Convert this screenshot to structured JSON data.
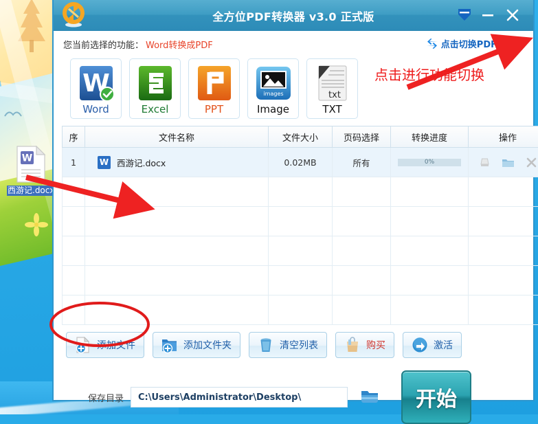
{
  "desktop": {
    "file_icon": {
      "name": "西游记.docx",
      "icon": "word-document-icon"
    }
  },
  "window": {
    "title": "全方位PDF转换器 v3.0 正式版",
    "logo_icon": "convert-arrows-logo",
    "controls": [
      {
        "name": "minimize-to-tray-button",
        "icon": "tray-arrow-icon"
      },
      {
        "name": "minimize-button",
        "icon": "minimize-icon"
      },
      {
        "name": "close-button",
        "icon": "close-icon"
      }
    ]
  },
  "function_bar": {
    "label": "您当前选择的功能：",
    "value": "Word转换成PDF",
    "switch_link": "点击切换PDF转文件",
    "switch_icon": "swap-arrows-icon"
  },
  "formats": [
    {
      "name": "Word",
      "icon": "word-icon",
      "selected": true
    },
    {
      "name": "Excel",
      "icon": "excel-icon",
      "selected": false
    },
    {
      "name": "PPT",
      "icon": "ppt-icon",
      "selected": false
    },
    {
      "name": "Image",
      "icon": "image-icon",
      "selected": false
    },
    {
      "name": "TXT",
      "icon": "txt-icon",
      "selected": false
    }
  ],
  "table": {
    "headers": [
      "序",
      "文件名称",
      "文件大小",
      "页码选择",
      "转换进度",
      "操作"
    ],
    "rows": [
      {
        "index": "1",
        "file_icon": "word-file-icon",
        "filename": "西游记.docx",
        "size": "0.02MB",
        "pages": "所有",
        "progress_text": "0%",
        "progress_percent": 0,
        "actions": [
          "preview-icon",
          "open-folder-icon",
          "remove-icon"
        ]
      }
    ],
    "empty_row_count": 5
  },
  "toolbar_buttons": [
    {
      "label": "添加文件",
      "icon": "add-file-icon",
      "color": "#1f5fa8"
    },
    {
      "label": "添加文件夹",
      "icon": "add-folder-icon",
      "color": "#1f5fa8"
    },
    {
      "label": "清空列表",
      "icon": "trash-icon",
      "color": "#1f5fa8"
    },
    {
      "label": "购买",
      "icon": "shopping-bag-icon",
      "color": "#d0342c"
    },
    {
      "label": "激活",
      "icon": "activate-arrow-icon",
      "color": "#1f5fa8"
    }
  ],
  "save_row": {
    "label": "保存目录",
    "path": "C:\\Users\\Administrator\\Desktop\\",
    "browse_icon": "folder-browse-icon",
    "start_button": "开始"
  },
  "annotations": {
    "switch_note": "点击进行功能切换",
    "note_color": "#ee1c1c",
    "arrow_color": "#ee2222",
    "ellipse_color": "#e01b1b"
  },
  "colors": {
    "titlebar": "#3392bc",
    "accent_blue": "#1565c0",
    "accent_red": "#e8442a",
    "start_teal": "#2ba3b0",
    "desktop": "#29abe8"
  }
}
